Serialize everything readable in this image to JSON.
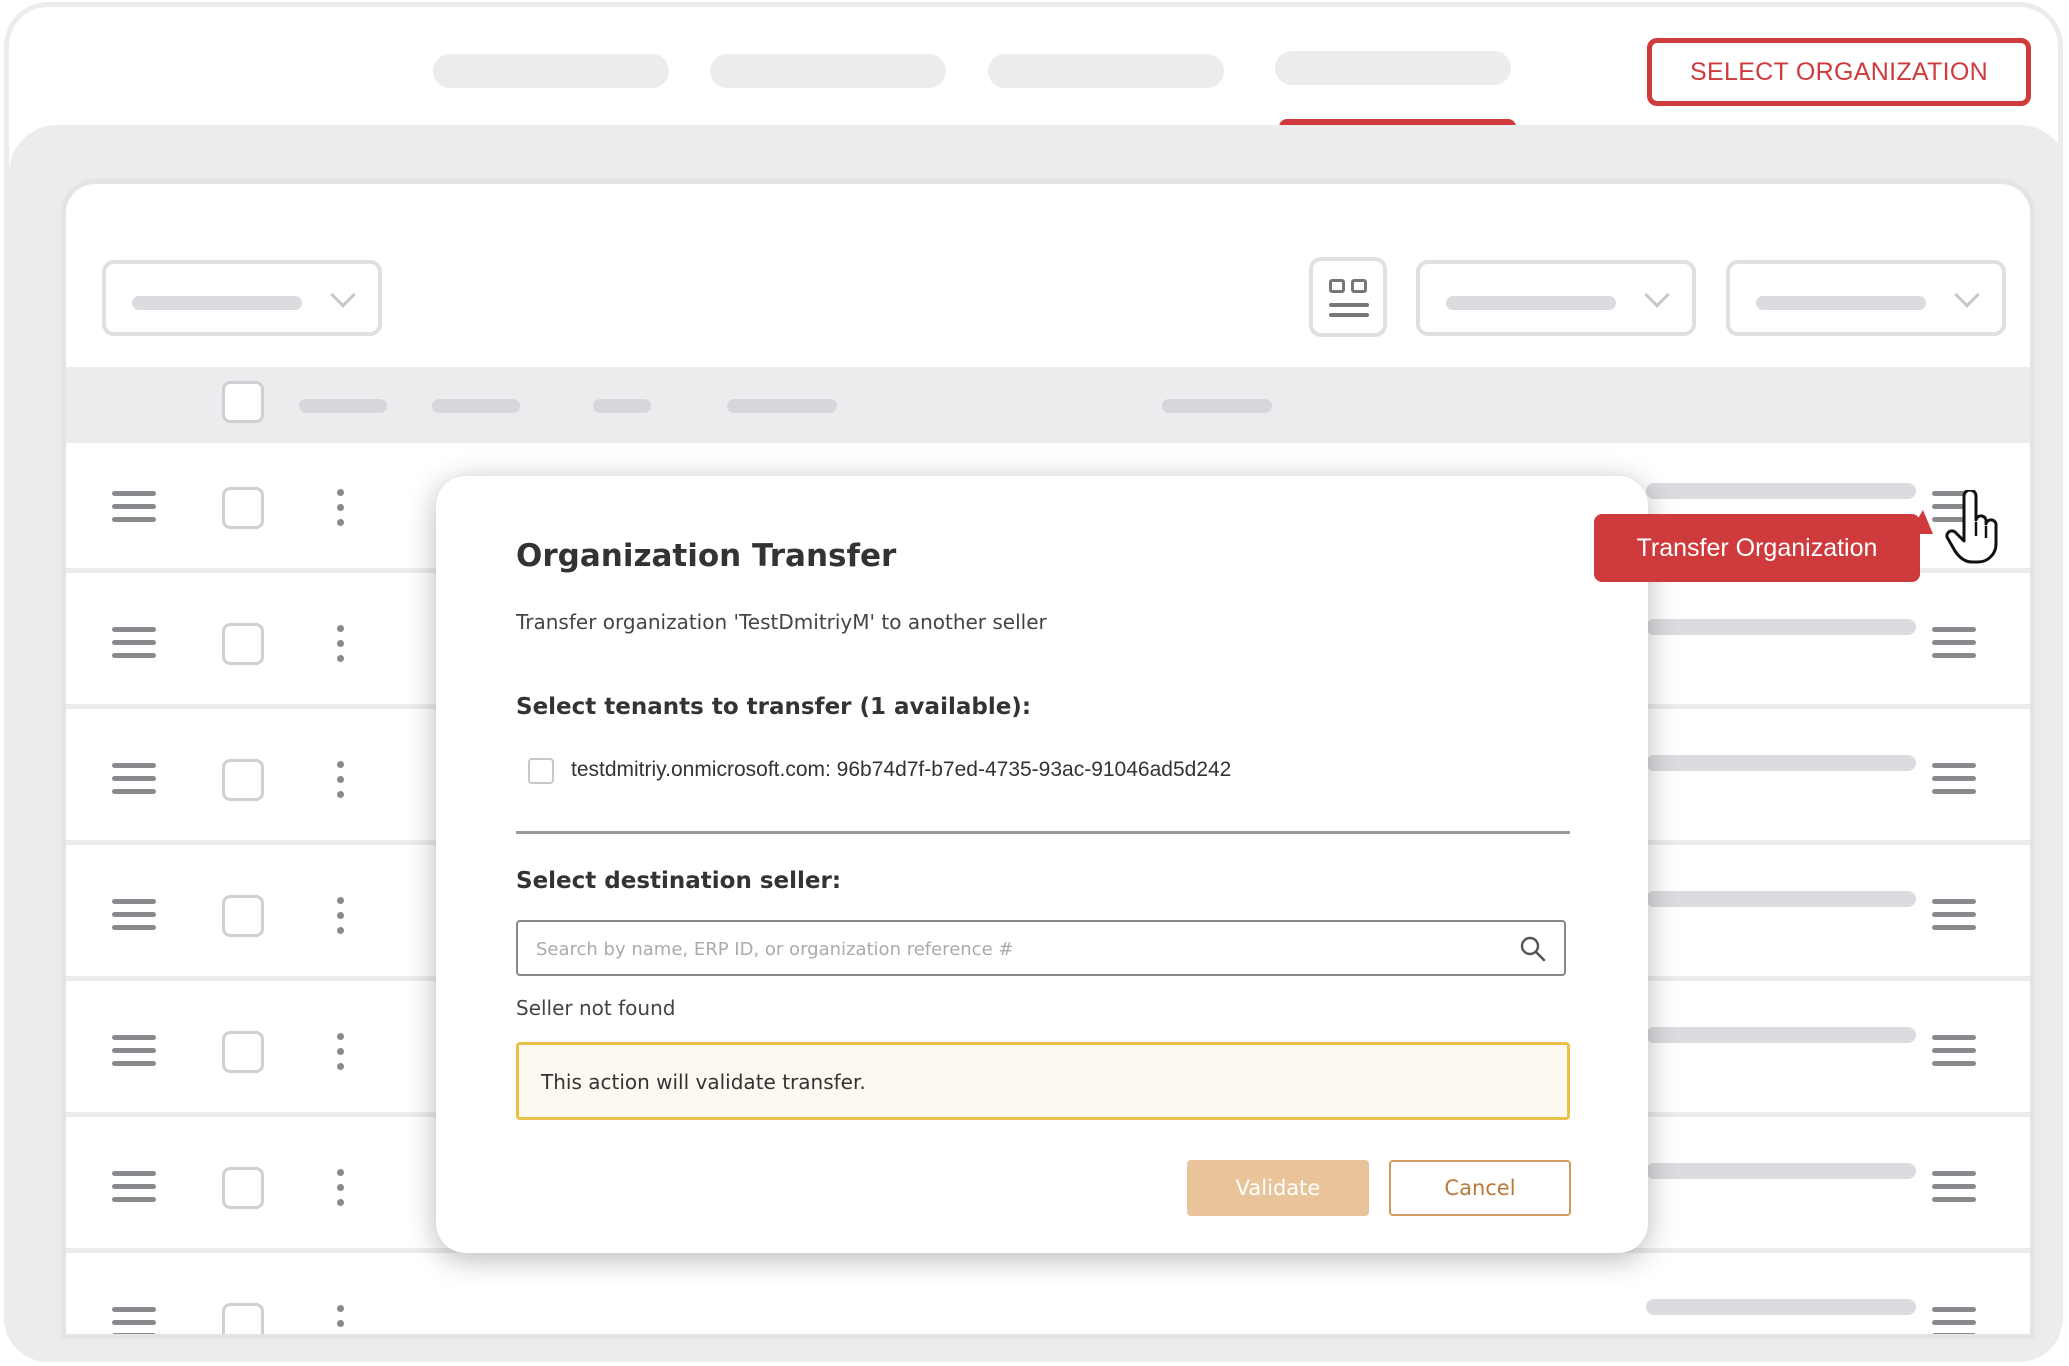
{
  "header": {
    "select_org_label": "SELECT ORGANIZATION"
  },
  "tooltip": {
    "label": "Transfer Organization"
  },
  "modal": {
    "title": "Organization Transfer",
    "subtitle": "Transfer organization 'TestDmitriyM' to another seller",
    "tenants_heading": "Select tenants to transfer (1 available):",
    "tenant_item": "testdmitriy.onmicrosoft.com: 96b74d7f-b7ed-4735-93ac-91046ad5d242",
    "seller_heading": "Select destination seller:",
    "search_placeholder": "Search by name, ERP ID, or organization reference #",
    "search_value": "",
    "not_found": "Seller not found",
    "notice": "This action will validate transfer.",
    "validate_label": "Validate",
    "cancel_label": "Cancel"
  },
  "icons": {
    "search": "search-icon",
    "cursor": "hand-pointer-icon",
    "row_drag": "drag-handle-icon",
    "row_menu": "more-vertical-icon",
    "view_toggle": "grid-view-icon"
  },
  "colors": {
    "accent": "#cf3a3c",
    "validate_bg": "#e9c49a",
    "notice_border": "#e9c14a"
  }
}
